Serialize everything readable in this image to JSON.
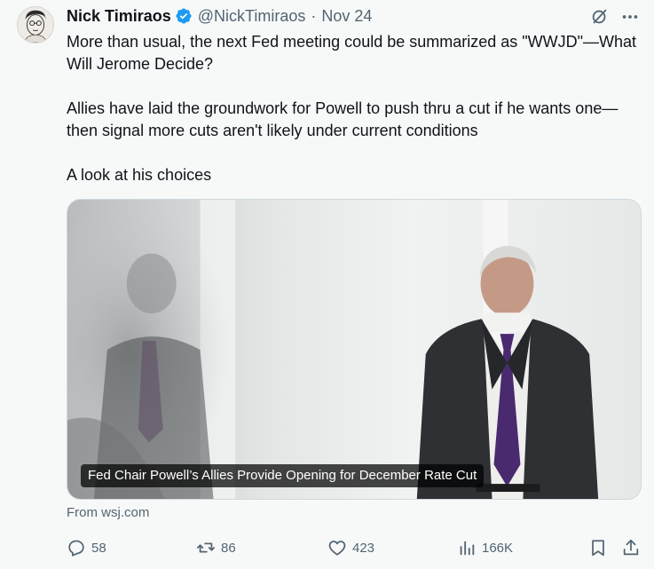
{
  "author": {
    "name": "Nick Timiraos",
    "handle": "@NickTimiraos",
    "separator": "·",
    "time": "Nov 24"
  },
  "body": {
    "paragraphs": [
      "More than usual, the next Fed meeting could be summarized as \"WWJD\"—What Will Jerome Decide?",
      "Allies have laid the groundwork for Powell to push thru a cut if he wants one—then signal more cuts aren't likely under current conditions",
      "A look at his choices"
    ]
  },
  "card": {
    "caption": "Fed Chair Powell’s Allies Provide Opening for December Rate Cut",
    "source": "From wsj.com"
  },
  "actions": {
    "replies": "58",
    "reposts": "86",
    "likes": "423",
    "views": "166K"
  },
  "colors": {
    "text": "#0f1419",
    "secondary": "#536471",
    "verified": "#1d9bf0",
    "background": "#f7f9f9"
  },
  "icons": [
    "verified-badge-icon",
    "grok-icon",
    "more-icon",
    "reply-icon",
    "repost-icon",
    "like-icon",
    "views-icon",
    "bookmark-icon",
    "share-icon"
  ]
}
